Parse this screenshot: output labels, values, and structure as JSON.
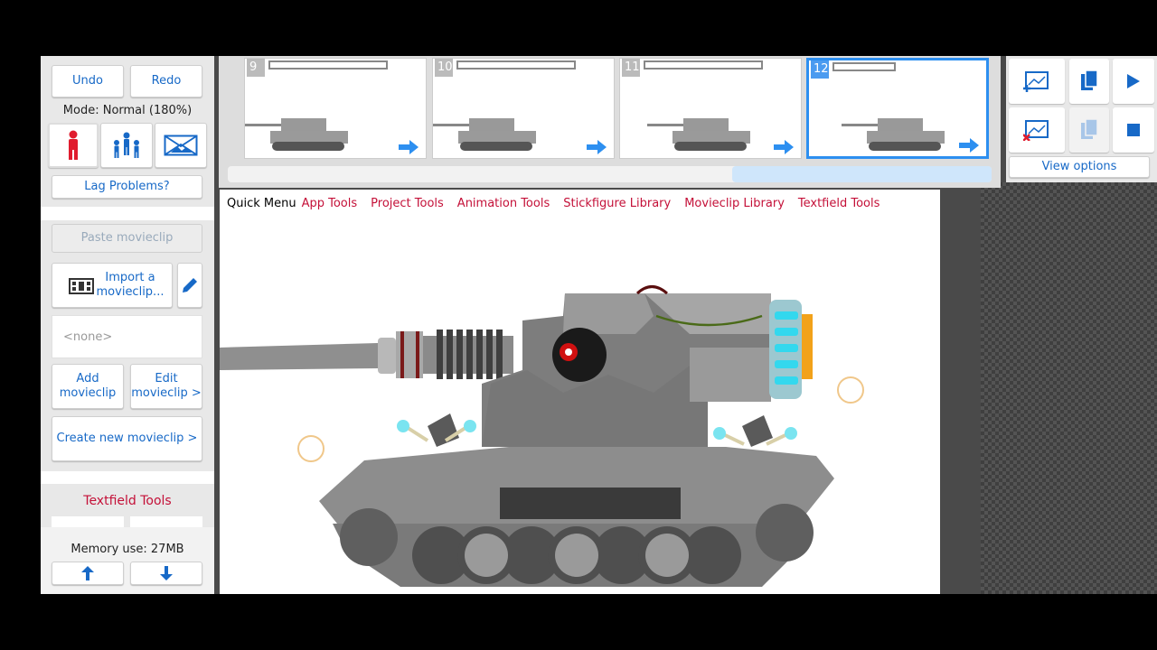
{
  "left_panel": {
    "undo": "Undo",
    "redo": "Redo",
    "mode": "Mode: Normal (180%)",
    "lag": "Lag Problems?",
    "paste": "Paste movieclip",
    "import": "Import a movieclip...",
    "clip_name": "<none>",
    "add": "Add movieclip",
    "edit": "Edit movieclip >",
    "create": "Create new movieclip >",
    "textfield_tools": "Textfield Tools",
    "memory": "Memory use: 27MB"
  },
  "timeline": {
    "frames": [
      {
        "number": "9",
        "selected": false
      },
      {
        "number": "10",
        "selected": false
      },
      {
        "number": "11",
        "selected": false
      },
      {
        "number": "12",
        "selected": true
      }
    ]
  },
  "right_panel": {
    "view_options": "View options"
  },
  "quick_menu": {
    "title": "Quick Menu",
    "items": [
      "App Tools",
      "Project Tools",
      "Animation Tools",
      "Stickfigure Library",
      "Movieclip Library",
      "Textfield Tools"
    ]
  },
  "colors": {
    "accent_blue": "#1769c7",
    "menu_red": "#c41038",
    "selected_frame": "#2d8ff0"
  }
}
